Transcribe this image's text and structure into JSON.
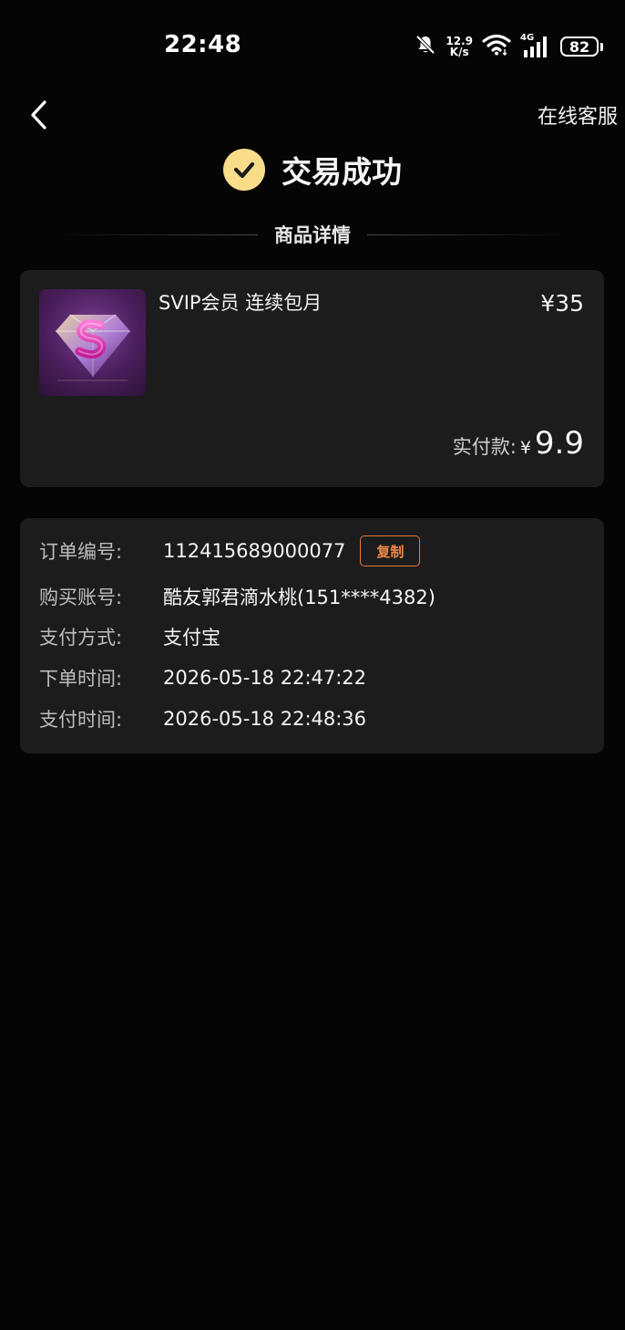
{
  "status_bar": {
    "time": "22:48",
    "net_speed_value": "12.9",
    "net_speed_unit": "K/s",
    "network_type": "4G",
    "battery": "82"
  },
  "nav": {
    "service_label": "在线客服"
  },
  "header": {
    "title": "交易成功"
  },
  "section": {
    "label": "商品详情"
  },
  "product": {
    "name": "SVIP会员 连续包月",
    "price": "¥35",
    "paid_label": "实付款:",
    "paid_currency": "¥",
    "paid_amount": "9.9"
  },
  "order": {
    "rows": [
      {
        "label": "订单编号:",
        "value": "112415689000077"
      },
      {
        "label": "购买账号:",
        "value": "酷友郭君滴水桃(151****4382)"
      },
      {
        "label": "支付方式:",
        "value": "支付宝"
      },
      {
        "label": "下单时间:",
        "value": "2026-05-18 22:47:22"
      },
      {
        "label": "支付时间:",
        "value": "2026-05-18 22:48:36"
      }
    ],
    "copy_label": "复制"
  },
  "colors": {
    "accent_gold": "#f8dc8a",
    "copy_orange": "#e3783e",
    "card_bg": "#1c1c1c",
    "page_bg": "#050505"
  }
}
